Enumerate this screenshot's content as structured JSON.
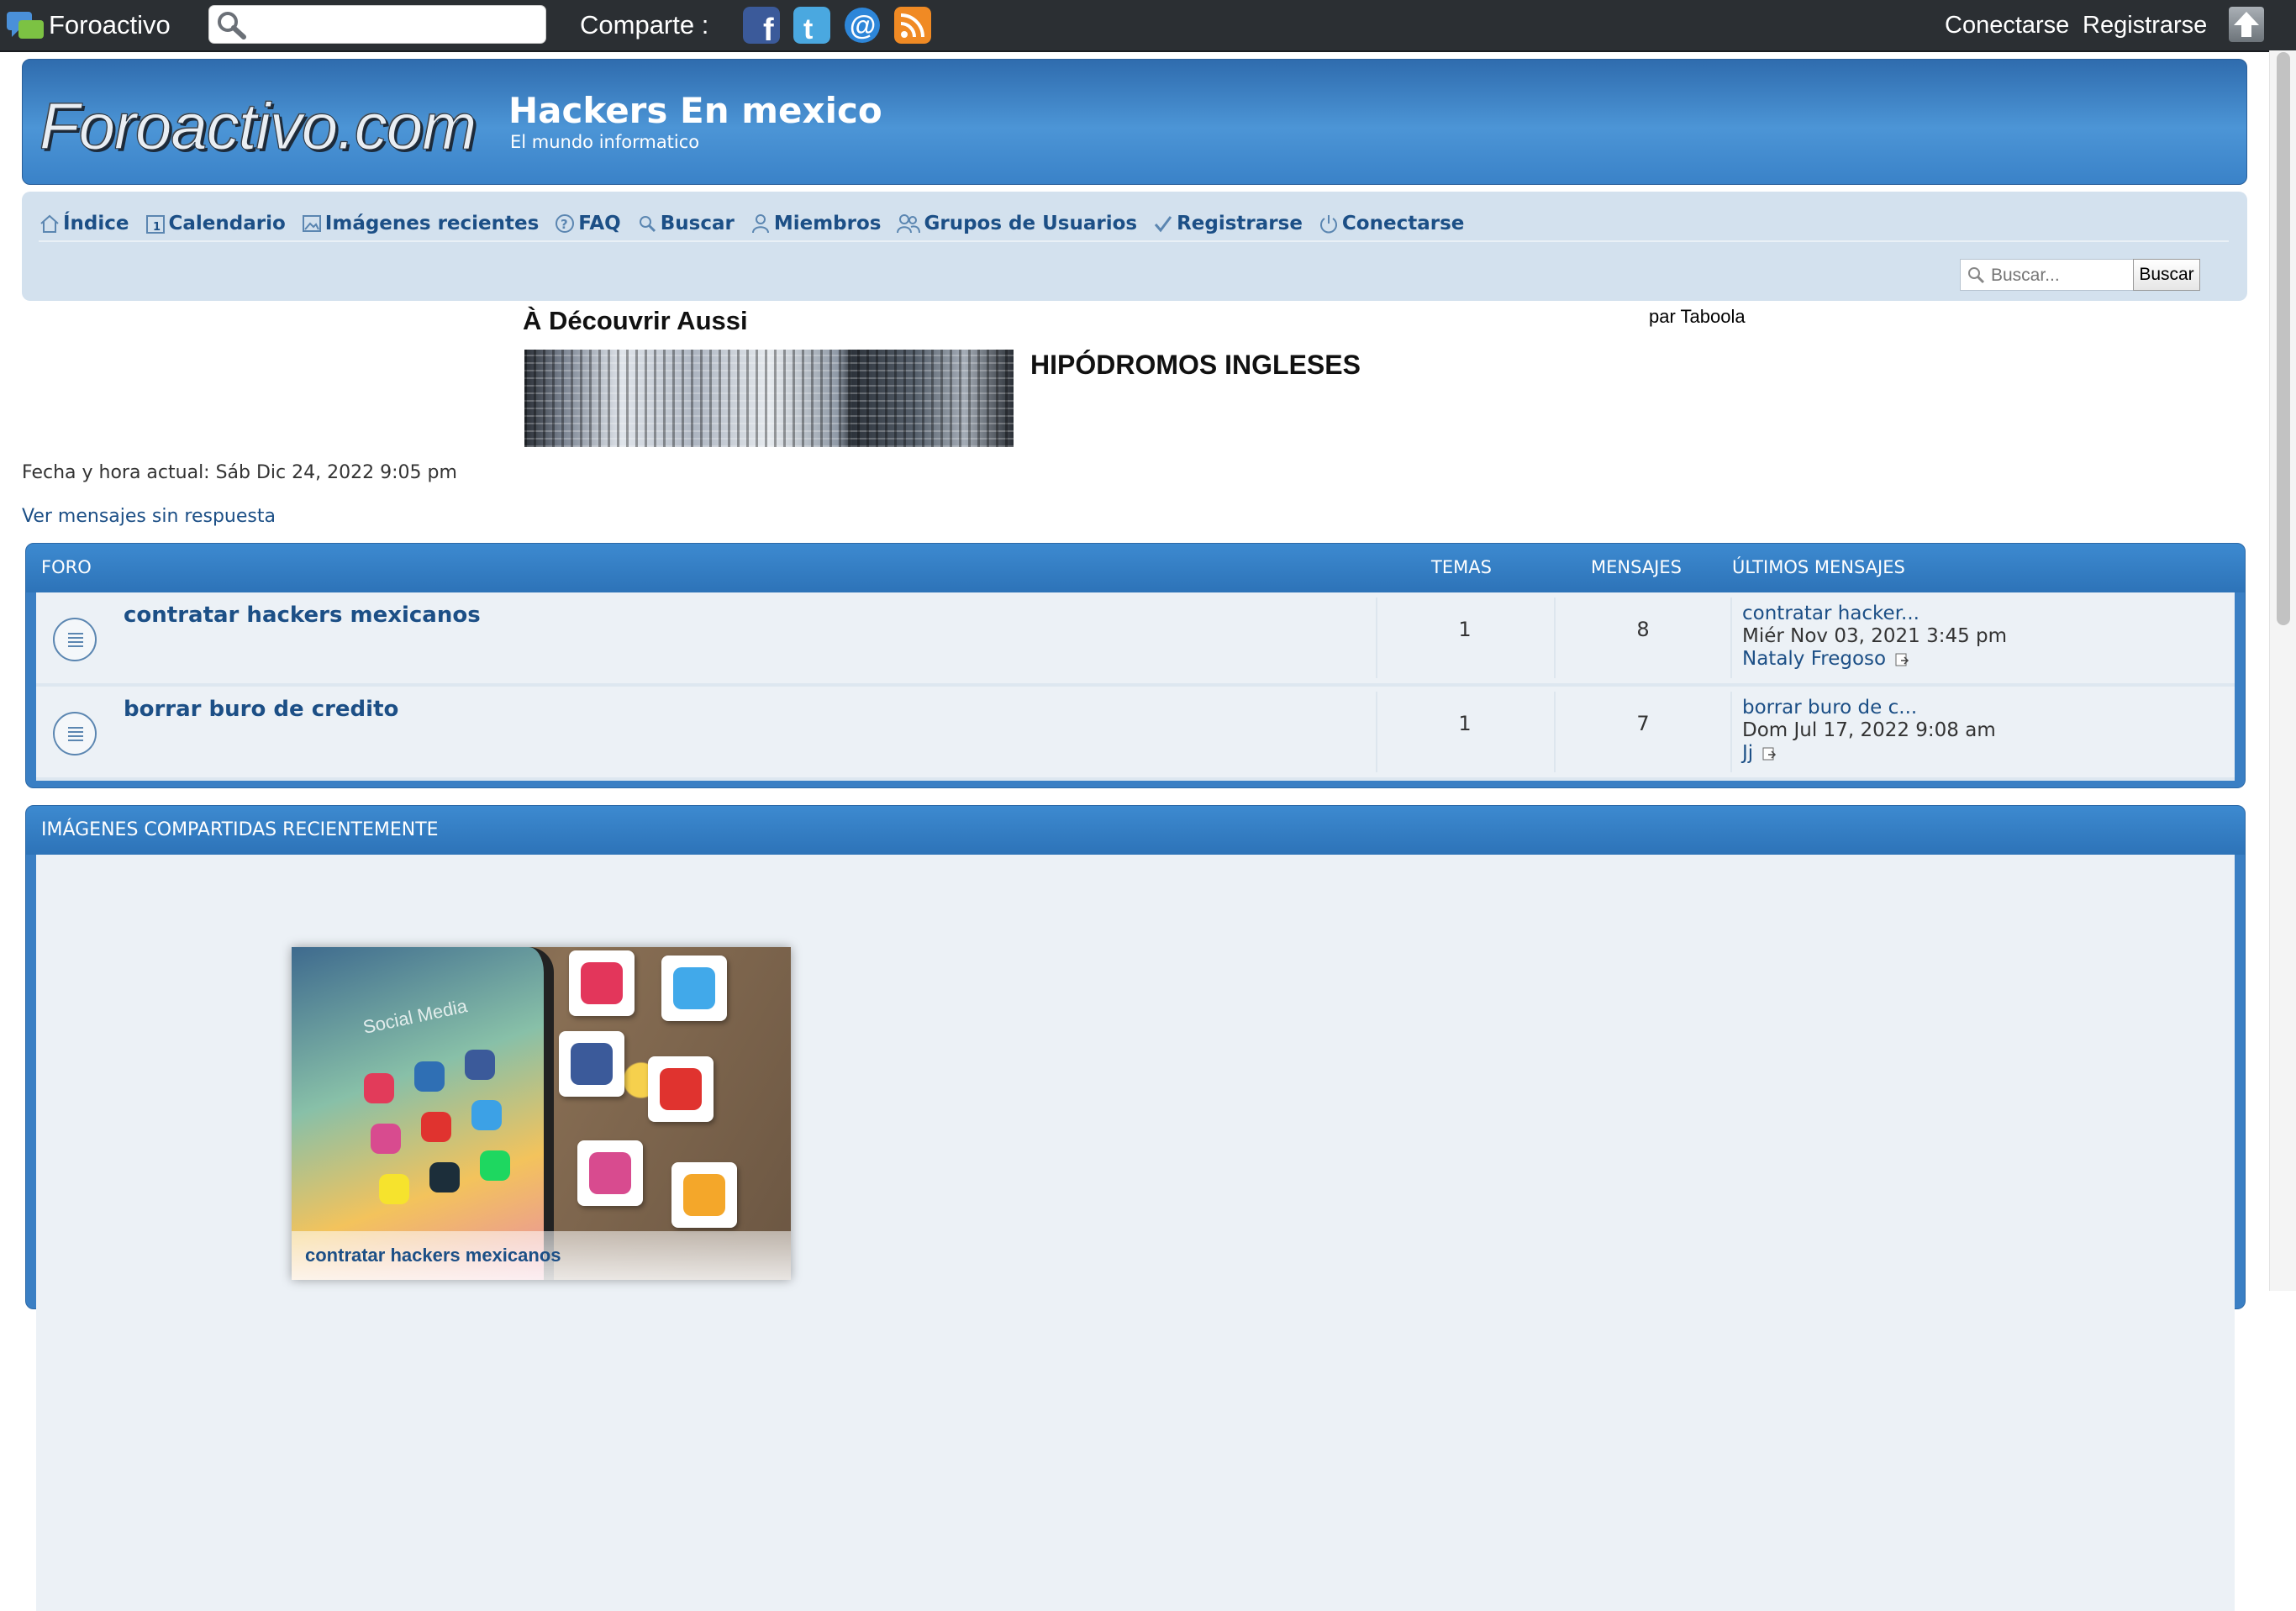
{
  "toolbar": {
    "brand": "Foroactivo",
    "search_placeholder": "",
    "share_label": "Comparte :",
    "share_icons": [
      "facebook-icon",
      "twitter-icon",
      "email-icon",
      "rss-icon"
    ],
    "login": "Conectarse",
    "register": "Registrarse"
  },
  "header": {
    "logo": "Foroactivo.com",
    "title": "Hackers En mexico",
    "description": "El mundo informatico"
  },
  "nav": {
    "items": [
      {
        "label": "Índice",
        "icon": "home-icon"
      },
      {
        "label": "Calendario",
        "icon": "calendar-icon"
      },
      {
        "label": "Imágenes recientes",
        "icon": "image-icon"
      },
      {
        "label": "FAQ",
        "icon": "help-icon"
      },
      {
        "label": "Buscar",
        "icon": "search-icon"
      },
      {
        "label": "Miembros",
        "icon": "user-icon"
      },
      {
        "label": "Grupos de Usuarios",
        "icon": "group-icon"
      },
      {
        "label": "Registrarse",
        "icon": "register-icon"
      },
      {
        "label": "Conectarse",
        "icon": "power-icon"
      }
    ],
    "search_placeholder": "Buscar...",
    "search_button": "Buscar"
  },
  "taboola": {
    "title": "À Découvrir Aussi",
    "by": "par Taboola",
    "headline": "HIPÓDROMOS INGLESES"
  },
  "info": {
    "datetime": "Fecha y hora actual: Sáb Dic 24, 2022 9:05 pm",
    "unanswered": "Ver mensajes sin respuesta"
  },
  "forum": {
    "headers": {
      "forum": "FORO",
      "topics": "TEMAS",
      "posts": "MENSAJES",
      "last": "ÚLTIMOS MENSAJES"
    },
    "rows": [
      {
        "title": "contratar hackers mexicanos",
        "topics": "1",
        "posts": "8",
        "last_title": "contratar hacker...",
        "last_date": "Miér Nov 03, 2021 3:45 pm",
        "last_user": "Nataly Fregoso"
      },
      {
        "title": "borrar buro de credito",
        "topics": "1",
        "posts": "7",
        "last_title": "borrar buro de c...",
        "last_date": "Dom Jul 17, 2022 9:08 am",
        "last_user": "Jj"
      }
    ]
  },
  "images_panel": {
    "title": "IMÁGENES COMPARTIDAS RECIENTEMENTE",
    "items": [
      {
        "caption": "contratar hackers mexicanos",
        "phone_label": "Social Media"
      }
    ]
  },
  "colors": {
    "accent": "#3a7fc4",
    "link": "#1c4f86",
    "toolbar": "#2b2f33",
    "nav_bg": "#d3e1ee"
  }
}
